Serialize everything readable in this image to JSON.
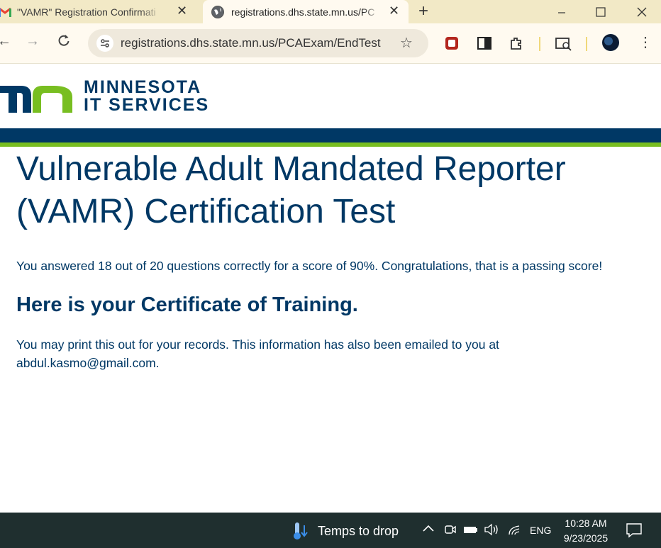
{
  "browser": {
    "tabs": [
      {
        "title": "\"VAMR\" Registration Confirmati",
        "favicon": "gmail-icon"
      },
      {
        "title": "registrations.dhs.state.mn.us/PC",
        "favicon": "globe-icon"
      }
    ],
    "url": "registrations.dhs.state.mn.us/PCAExam/EndTest"
  },
  "header": {
    "logo_line1": "MINNESOTA",
    "logo_line2": "IT SERVICES",
    "colors": {
      "navy": "#003865",
      "green": "#78be21"
    }
  },
  "main": {
    "title": "Vulnerable Adult Mandated Reporter (VAMR) Certification Test",
    "score_text": "You answered 18 out of 20 questions correctly for a score of 90%. Congratulations, that is a passing score!",
    "certificate_heading": "Here is your Certificate of Training.",
    "note_text": "You may print this out for your records. This information has also been emailed to you at abdul.kasmo@gmail.com."
  },
  "taskbar": {
    "weather_text": "Temps to drop",
    "language": "ENG",
    "time": "10:28 AM",
    "date": "9/23/2025"
  }
}
